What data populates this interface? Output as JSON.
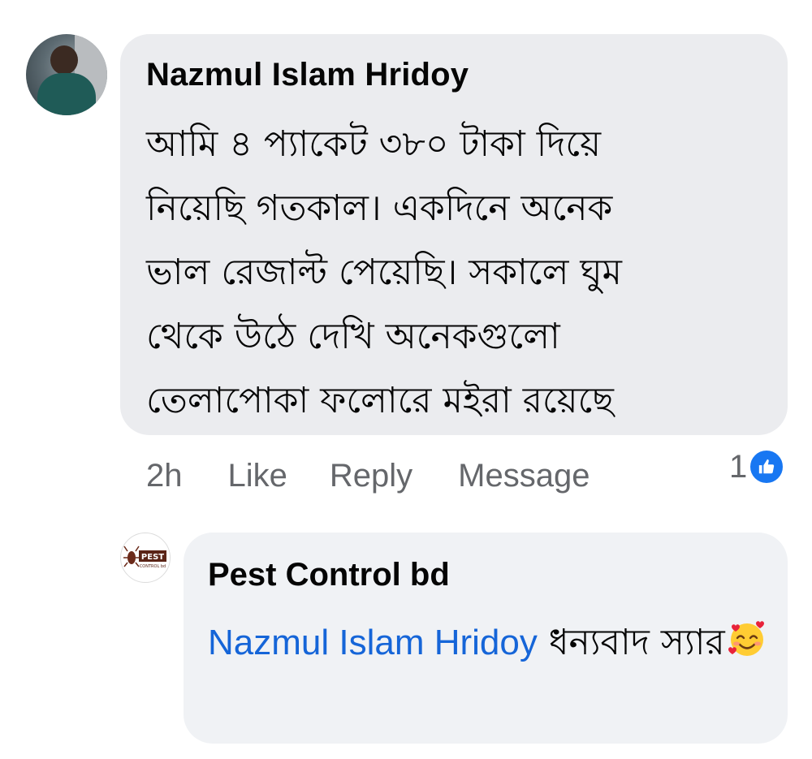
{
  "comment": {
    "author": "Nazmul Islam Hridoy",
    "text": "আমি ৪ প্যাকেট ৩৮০ টাকা দিয়ে\nনিয়েছি গতকাল। একদিনে অনেক\nভাল রেজাল্ট পেয়েছি। সকালে ঘুম\nথেকে উঠে দেখি অনেকগুলো\nতেলাপোকা ফলোরে  মইরা রয়েছে",
    "time": "2h",
    "like_label": "Like",
    "reply_label": "Reply",
    "message_label": "Message",
    "reaction_count": "1",
    "reaction_icon": "thumbs-up-icon",
    "reaction_color": "#1877f2"
  },
  "reply": {
    "author": "Pest Control bd",
    "mention": "Nazmul Islam Hridoy",
    "text": " ধন্যবাদ স্যার",
    "emoji": "smiling-face-with-hearts",
    "mention_color": "#1565d8",
    "avatar_logo_text": "PEST CONTROL bd"
  }
}
